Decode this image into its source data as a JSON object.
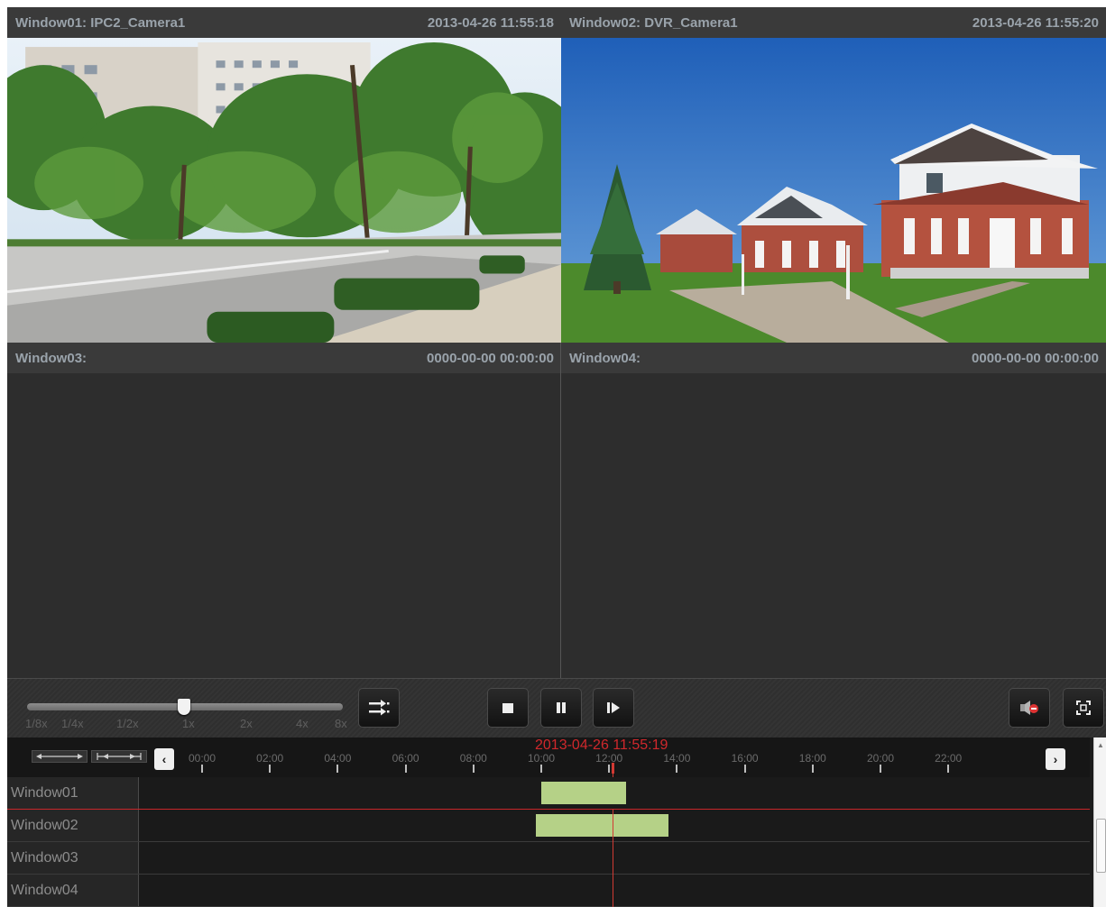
{
  "windows": [
    {
      "title": "Window01: IPC2_Camera1",
      "timestamp": "2013-04-26 11:55:18",
      "selected": true,
      "has_video": true
    },
    {
      "title": "Window02: DVR_Camera1",
      "timestamp": "2013-04-26 11:55:20",
      "selected": false,
      "has_video": true
    },
    {
      "title": "Window03:",
      "timestamp": "0000-00-00 00:00:00",
      "selected": false,
      "has_video": false
    },
    {
      "title": "Window04:",
      "timestamp": "0000-00-00 00:00:00",
      "selected": false,
      "has_video": false
    }
  ],
  "controls": {
    "speed_labels": [
      "1/8x",
      "1/4x",
      "1/2x",
      "1x",
      "2x",
      "4x",
      "8x"
    ],
    "speed_selected": "1x",
    "icons": {
      "mode": "playback-mode-icon",
      "stop": "stop-icon",
      "pause": "pause-icon",
      "step": "single-frame-icon",
      "audio": "audio-mute-icon",
      "fullscreen": "fullscreen-icon"
    }
  },
  "timeline": {
    "current_time": "2013-04-26 11:55:19",
    "hours": [
      "00:00",
      "02:00",
      "04:00",
      "06:00",
      "08:00",
      "10:00",
      "12:00",
      "14:00",
      "16:00",
      "18:00",
      "20:00",
      "22:00"
    ],
    "tracks": [
      {
        "label": "Window01",
        "selected": true,
        "segments": [
          {
            "start": "10:00",
            "end": "12:30"
          }
        ]
      },
      {
        "label": "Window02",
        "selected": false,
        "segments": [
          {
            "start": "09:50",
            "end": "13:45"
          }
        ]
      },
      {
        "label": "Window03",
        "selected": false,
        "segments": []
      },
      {
        "label": "Window04",
        "selected": false,
        "segments": []
      }
    ],
    "segment_color": "#b5d187",
    "cursor_color": "#d23a33"
  },
  "colors": {
    "selection": "#c8262a",
    "header_text": "#9aa3ab"
  }
}
